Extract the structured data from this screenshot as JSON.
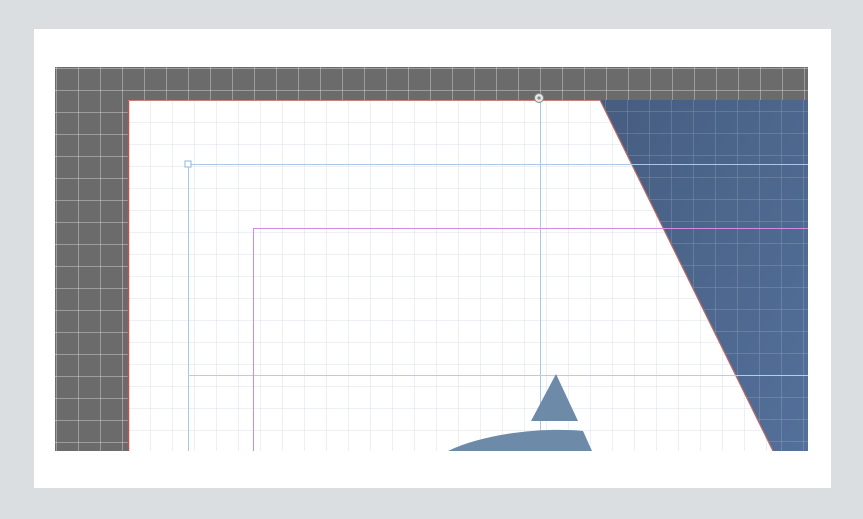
{
  "app": {
    "view": "layout-editor-canvas"
  },
  "colors": {
    "pasteboard": "#6b6b6b",
    "page": "#ffffff",
    "page_grid": "#d7dee6",
    "bleed_line": "#c0504d",
    "guide_blue": "#9ec3e6",
    "guide_cyan": "#8fd9e8",
    "margin_guide": "#cc77dd",
    "shape_fill": "#4c6688",
    "emblem_fill": "#6d8aa6"
  },
  "canvas": {
    "grid_visible": true,
    "guides_visible": true
  },
  "icons": {
    "transform_handle": "rotation-handle-icon",
    "frame_anchor": "anchor-point-icon"
  }
}
